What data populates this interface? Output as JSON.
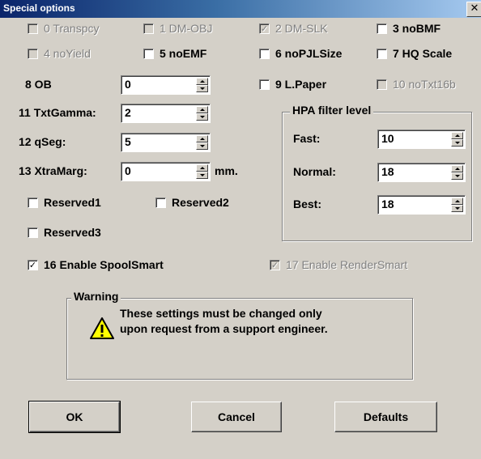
{
  "window": {
    "title": "Special options",
    "close": "✕"
  },
  "checkboxes": {
    "c0": {
      "label": "0 Transpcy",
      "checked": false,
      "enabled": false
    },
    "c1": {
      "label": "1 DM-OBJ",
      "checked": false,
      "enabled": false
    },
    "c2": {
      "label": "2 DM-SLK",
      "checked": true,
      "enabled": false
    },
    "c3": {
      "label": "3 noBMF",
      "checked": false,
      "enabled": true
    },
    "c4": {
      "label": "4 noYield",
      "checked": false,
      "enabled": false
    },
    "c5": {
      "label": "5 noEMF",
      "checked": false,
      "enabled": true
    },
    "c6": {
      "label": "6 noPJLSize",
      "checked": false,
      "enabled": true
    },
    "c7": {
      "label": "7 HQ Scale",
      "checked": false,
      "enabled": true
    },
    "c9": {
      "label": "9 L.Paper",
      "checked": false,
      "enabled": true
    },
    "c10": {
      "label": "10 noTxt16b",
      "checked": false,
      "enabled": false
    },
    "r1": {
      "label": "Reserved1",
      "checked": false,
      "enabled": true
    },
    "r2": {
      "label": "Reserved2",
      "checked": false,
      "enabled": true
    },
    "r3": {
      "label": "Reserved3",
      "checked": false,
      "enabled": true
    },
    "c16": {
      "label": "16 Enable SpoolSmart",
      "checked": true,
      "enabled": true
    },
    "c17": {
      "label": "17 Enable RenderSmart",
      "checked": true,
      "enabled": false
    }
  },
  "fields": {
    "ob": {
      "label": "8 OB",
      "value": "0"
    },
    "txtgamma": {
      "label": "11 TxtGamma:",
      "value": "2"
    },
    "qseg": {
      "label": "12 qSeg:",
      "value": "5"
    },
    "xtramarg": {
      "label": "13 XtraMarg:",
      "value": "0",
      "unit": "mm."
    }
  },
  "hpa": {
    "title": "HPA filter level",
    "fast": {
      "label": "Fast:",
      "value": "10"
    },
    "normal": {
      "label": "Normal:",
      "value": "18"
    },
    "best": {
      "label": "Best:",
      "value": "18"
    }
  },
  "warning": {
    "title": "Warning",
    "icon": "warning-triangle-icon",
    "line1": "These settings must be changed only",
    "line2": "upon request from a support engineer."
  },
  "buttons": {
    "ok": "OK",
    "cancel": "Cancel",
    "defaults": "Defaults"
  },
  "check_mark": "✓"
}
